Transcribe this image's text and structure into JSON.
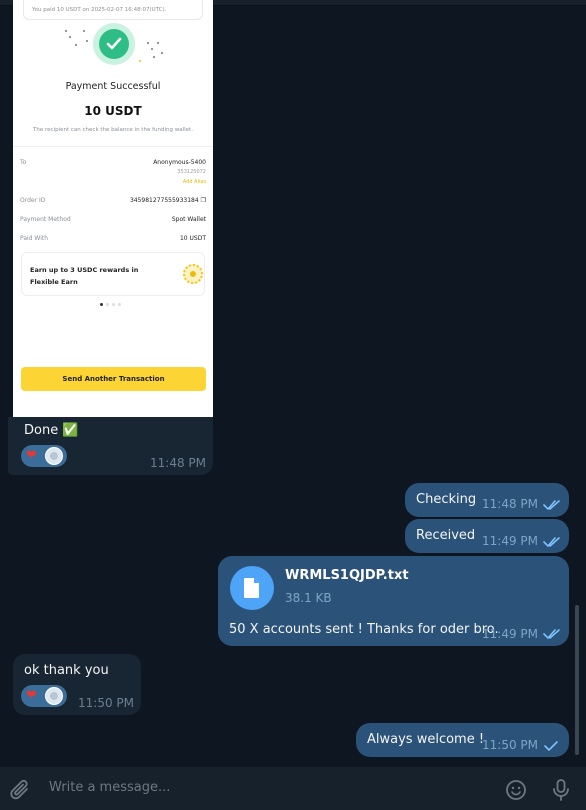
{
  "screenshot": {
    "top_card_line1": "You paid 10 USDT on 2025-02-07 16:48:07(UTC).",
    "payment_title": "Payment Successful",
    "amount": "10 USDT",
    "note": "The recipient can check the balance in the funding wallet.",
    "to_label": "To",
    "to_value": "Anonymous-5400",
    "to_id": "353125072",
    "add_alias": "Add Alias",
    "order_label": "Order ID",
    "order_value": "345981277555933184",
    "method_label": "Payment Method",
    "method_value": "Spot Wallet",
    "paid_label": "Paid With",
    "paid_value": "10 USDT",
    "promo_text": "Earn up to 3 USDC rewards in Flexible Earn",
    "send_button": "Send Another Transaction"
  },
  "messages": {
    "done": {
      "text": "Done ✅",
      "time": "11:48 PM"
    },
    "checking": {
      "text": "Checking",
      "time": "11:48 PM"
    },
    "received": {
      "text": "Received",
      "time": "11:49 PM"
    },
    "file": {
      "name": "WRMLS1QJDP.txt",
      "size": "38.1 KB",
      "caption": "50 X accounts sent ! Thanks for oder bro.",
      "time": "11:49 PM"
    },
    "ok": {
      "text": "ok thank you",
      "time": "11:50 PM"
    },
    "welcome": {
      "text": "Always welcome !",
      "time": "11:50 PM"
    }
  },
  "reactions": {
    "heart": "❤"
  },
  "composer": {
    "placeholder": "Write a message..."
  },
  "icons": {
    "attach": "paperclip-icon",
    "emoji": "smile-icon",
    "mic": "microphone-icon",
    "file": "document-icon",
    "read": "double-check-icon"
  },
  "colors": {
    "background": "#0e1621",
    "incoming_bubble": "#182533",
    "outgoing_bubble": "#2b5278",
    "accent": "#4ea4f6",
    "composer": "#17212b"
  }
}
